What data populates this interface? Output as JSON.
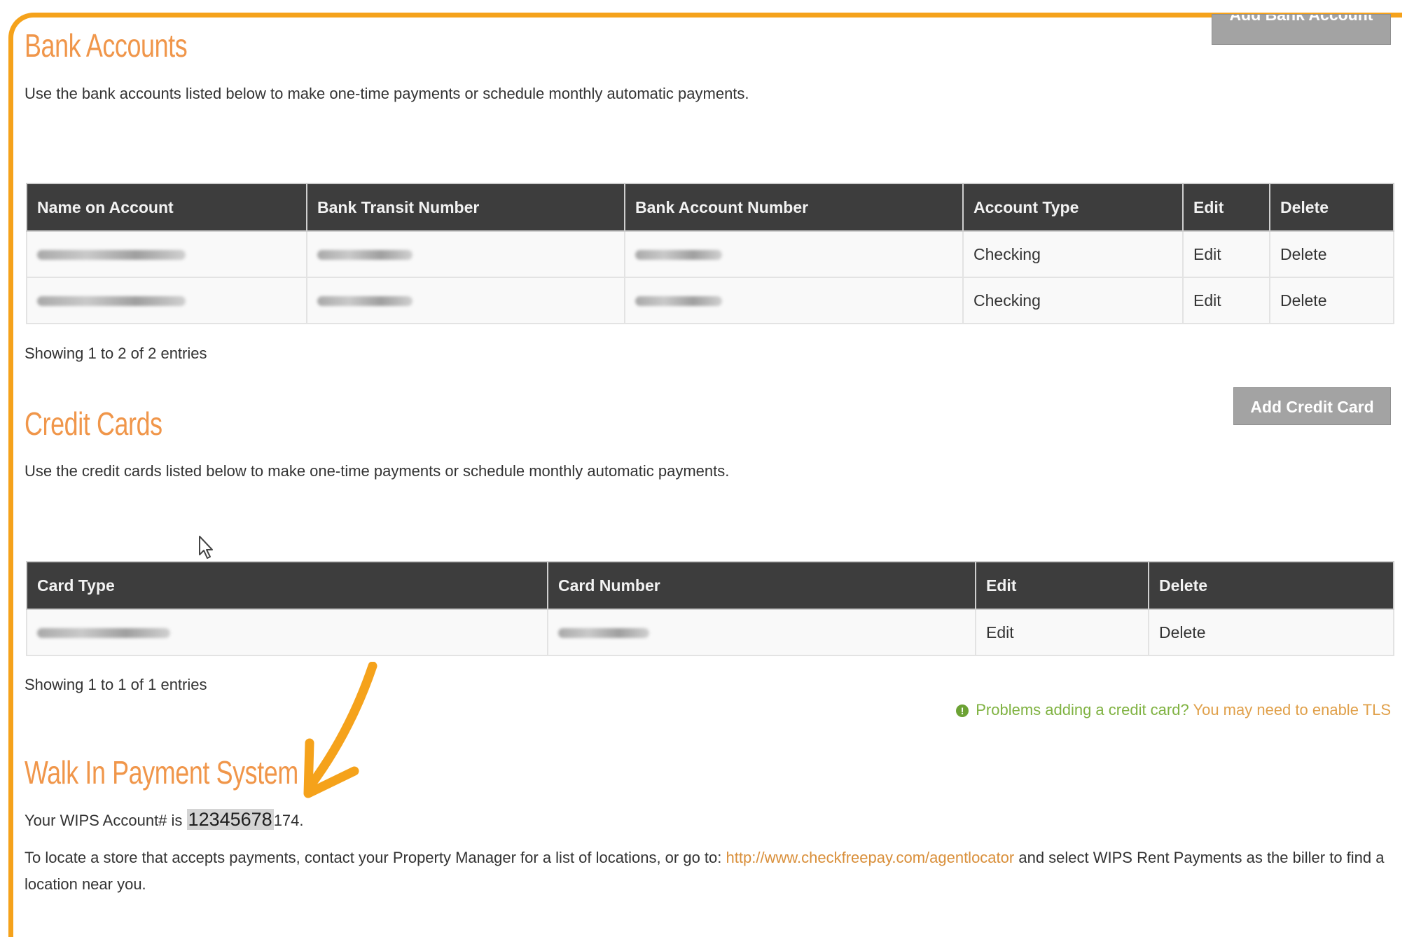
{
  "bank": {
    "title": "Bank Accounts",
    "add_button": "Add Bank Account",
    "description": "Use the bank accounts listed below to make one-time payments or schedule monthly automatic payments.",
    "columns": [
      "Name on Account",
      "Bank Transit Number",
      "Bank Account Number",
      "Account Type",
      "Edit",
      "Delete"
    ],
    "rows": [
      {
        "account_type": "Checking",
        "edit": "Edit",
        "delete": "Delete"
      },
      {
        "account_type": "Checking",
        "edit": "Edit",
        "delete": "Delete"
      }
    ],
    "showing": "Showing 1 to 2 of 2 entries"
  },
  "credit": {
    "title": "Credit Cards",
    "add_button": "Add Credit Card",
    "description": "Use the credit cards listed below to make one-time payments or schedule monthly automatic payments.",
    "columns": [
      "Card Type",
      "Card Number",
      "Edit",
      "Delete"
    ],
    "rows": [
      {
        "edit": "Edit",
        "delete": "Delete"
      }
    ],
    "showing": "Showing 1 to 1 of 1 entries",
    "notice_icon": "info-icon",
    "notice_green": "Problems adding a credit card?",
    "notice_orange": "You may need to enable TLS"
  },
  "wips": {
    "title": "Walk In Payment System",
    "account_prefix": "Your WIPS Account# is",
    "account_number": "12345678",
    "account_suffix": "174.",
    "locate_text": "To locate a store that accepts payments, contact your Property Manager for a list of locations, or go to:",
    "locate_link": "http://www.checkfreepay.com/agentlocator",
    "locate_suffix": "and select WIPS Rent Payments as the biller to find a location near you."
  },
  "colors": {
    "frame": "#f5a21b",
    "heading": "#f0964a",
    "table_header": "#3d3d3d",
    "notice_green": "#7fb241",
    "link": "#d98f3a"
  }
}
